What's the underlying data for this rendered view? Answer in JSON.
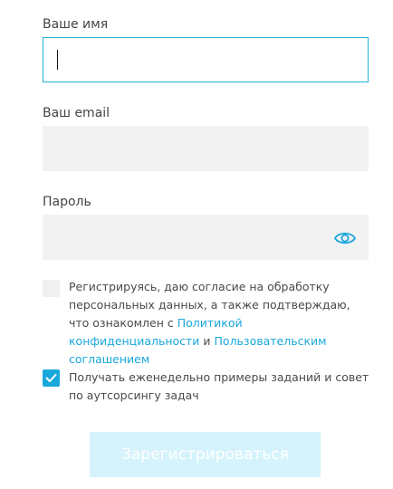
{
  "form": {
    "name": {
      "label": "Ваше имя",
      "value": ""
    },
    "email": {
      "label": "Ваш email",
      "value": ""
    },
    "password": {
      "label": "Пароль",
      "value": "",
      "toggle_icon": "eye-icon"
    },
    "consent": {
      "checked": false,
      "text_before": "Регистрируясь, даю согласие на обработку персональных данных, а также подтверждаю, что ознакомлен с ",
      "privacy_link": "Политикой конфиденциальности",
      "and": " и ",
      "terms_link": "Пользовательским соглашением"
    },
    "newsletter": {
      "checked": true,
      "text": "Получать еженедельно примеры заданий и совет по аутсорсингу задач"
    },
    "submit_label": "Зарегистрироваться"
  },
  "colors": {
    "accent": "#1aa7dc",
    "focus_border": "#23b3d6",
    "input_bg": "#f2f2f2",
    "button_disabled_bg": "#d5f3fc"
  }
}
